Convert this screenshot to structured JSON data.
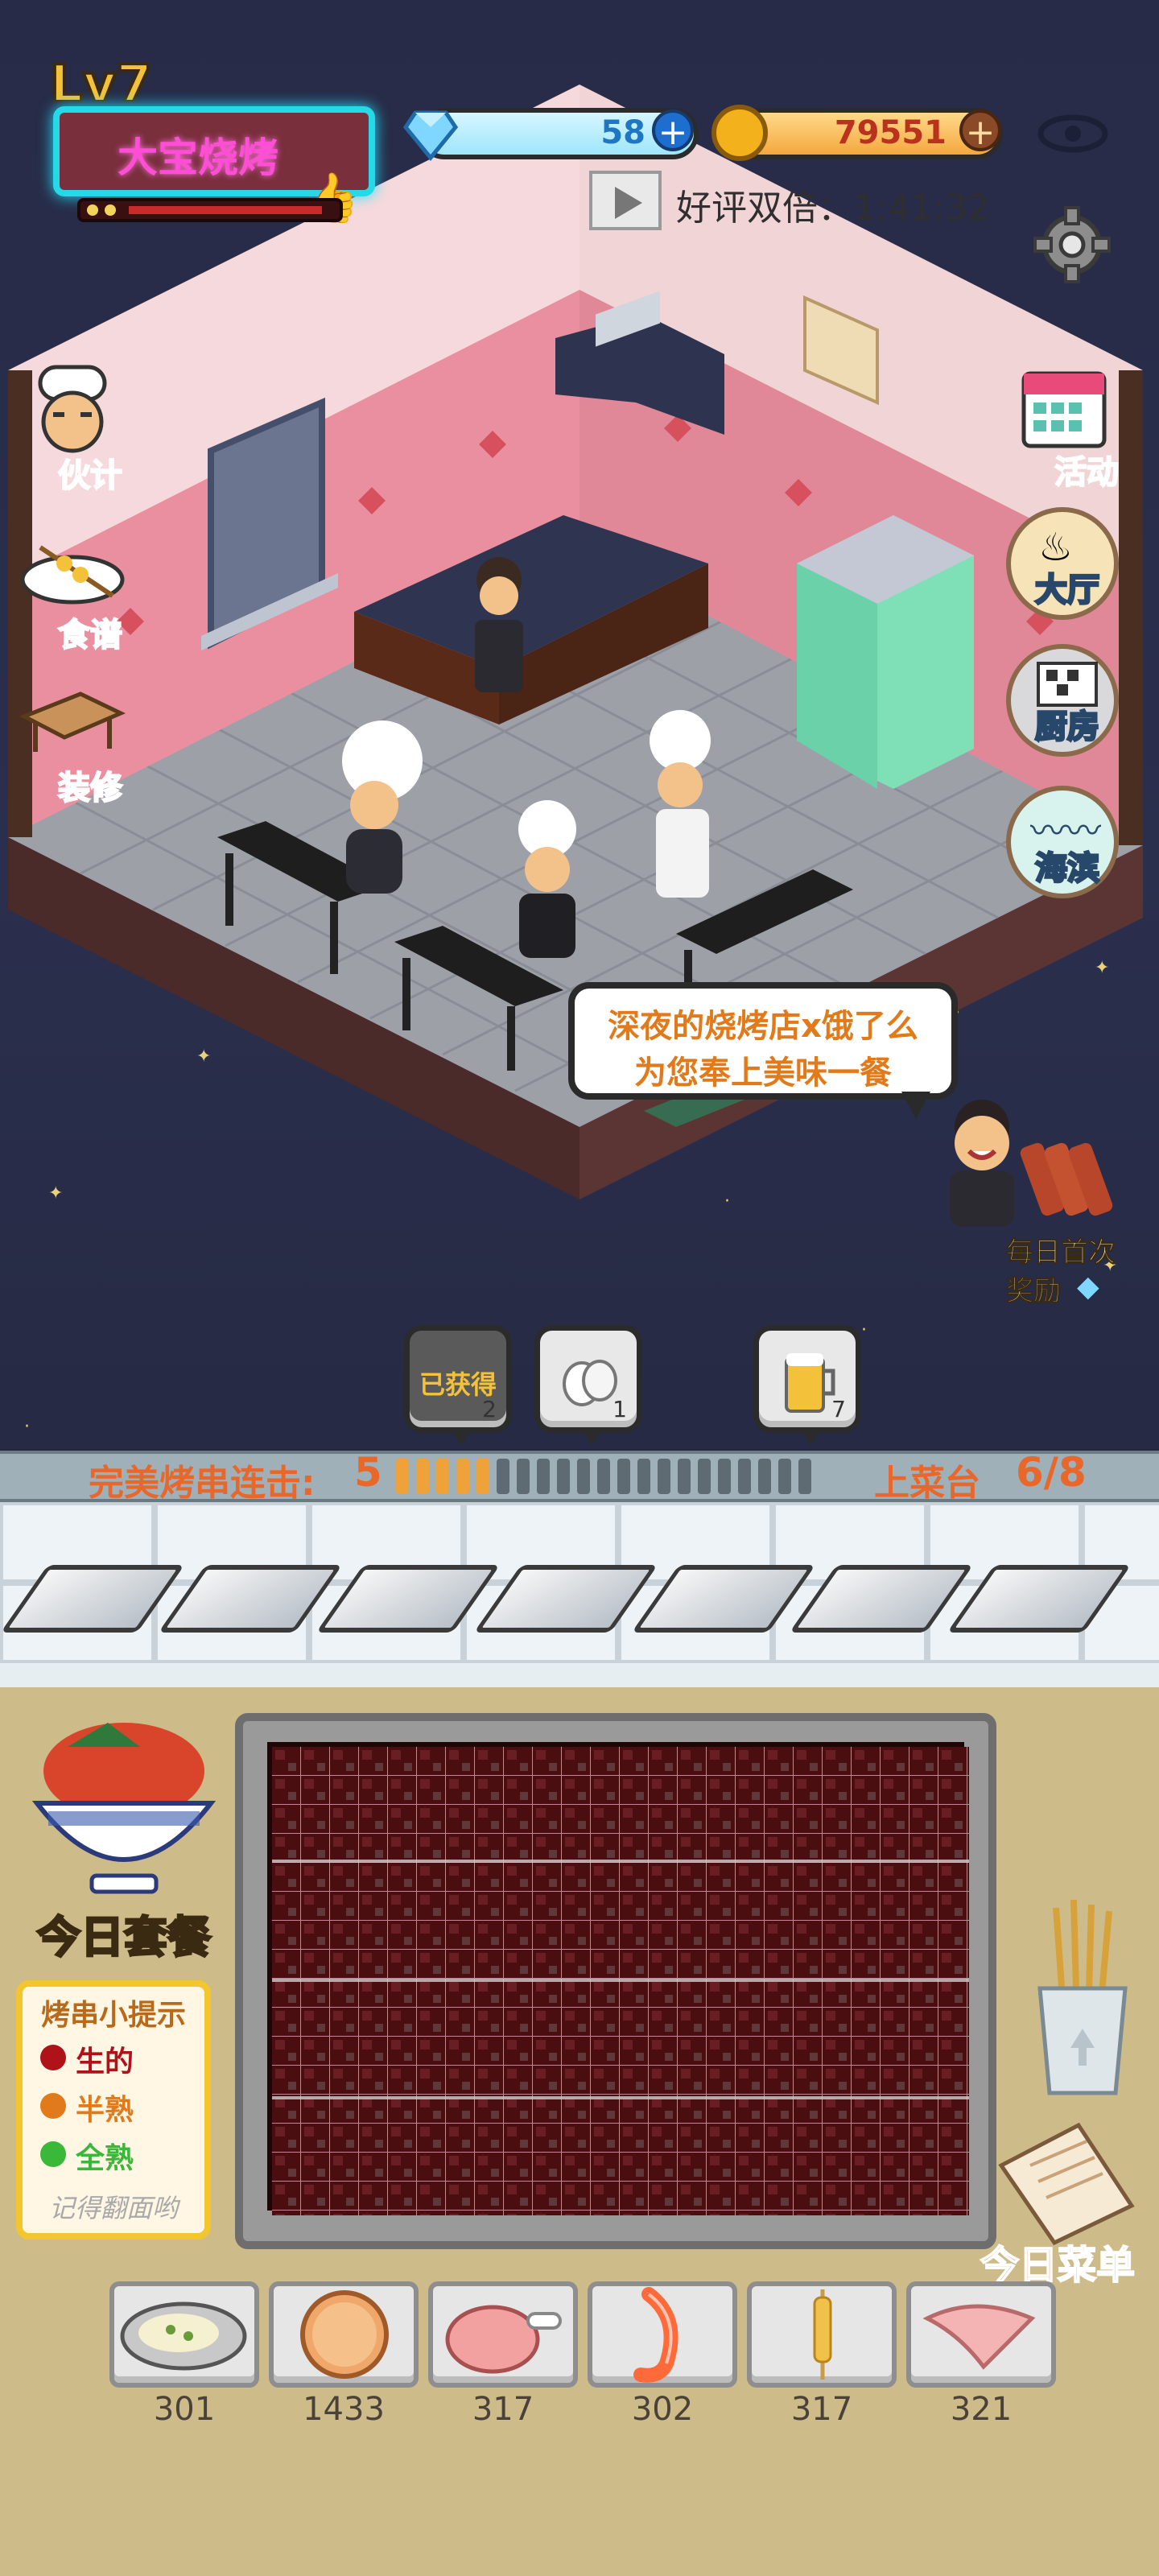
{
  "hud": {
    "level": "Lv7",
    "shop_name": "大宝烧烤",
    "gems": "58",
    "coins": "79551",
    "video_reward_text": "好评双倍：1:41:32"
  },
  "side_menu_left": [
    {
      "label": "伙计",
      "icon": "waiter-icon"
    },
    {
      "label": "食谱",
      "icon": "recipe-icon"
    },
    {
      "label": "装修",
      "icon": "decorate-icon"
    }
  ],
  "side_menu_right": [
    {
      "label": "活动",
      "icon": "calendar-icon"
    },
    {
      "label": "大厅",
      "icon": "hall-icon"
    },
    {
      "label": "厨房",
      "icon": "kitchen-icon"
    },
    {
      "label": "海滨",
      "icon": "seaside-icon"
    }
  ],
  "speech": {
    "line1": "深夜的烧烤店x饿了么",
    "line2": "为您奉上美味一餐"
  },
  "daily_reward": {
    "line1": "每日首次",
    "line2": "奖励"
  },
  "item_slots": [
    {
      "label": "已获得",
      "count": "2",
      "icon": "grill-plate-icon"
    },
    {
      "label": "",
      "count": "1",
      "icon": "garlic-icon"
    },
    {
      "label": "",
      "count": "7",
      "icon": "beer-icon"
    }
  ],
  "combo": {
    "label": "完美烤串连击:",
    "value": "5",
    "segments_total": 21,
    "segments_filled": 5
  },
  "tray": {
    "label": "上菜台",
    "value": "6/8"
  },
  "today_meal": {
    "label": "今日套餐"
  },
  "tips": {
    "title": "烤串小提示",
    "items": [
      {
        "text": "生的",
        "color": "#b0121a"
      },
      {
        "text": "半熟",
        "color": "#e07a1a"
      },
      {
        "text": "全熟",
        "color": "#3ab83a"
      }
    ],
    "footer": "记得翻面哟"
  },
  "today_menu": {
    "label": "今日菜单"
  },
  "ingredients": [
    {
      "name": "oyster-icon",
      "count": "301"
    },
    {
      "name": "bread-icon",
      "count": "1433"
    },
    {
      "name": "chicken-leg-icon",
      "count": "317"
    },
    {
      "name": "shrimp-icon",
      "count": "302"
    },
    {
      "name": "skewer-icon",
      "count": "317"
    },
    {
      "name": "chicken-wing-icon",
      "count": "321"
    }
  ],
  "colors": {
    "accent_orange": "#e8672a",
    "gem_blue": "#1f76c2",
    "coin_red": "#b8321e",
    "neon_pink": "#ff4ed6",
    "neon_cyan": "#25d9e6"
  }
}
